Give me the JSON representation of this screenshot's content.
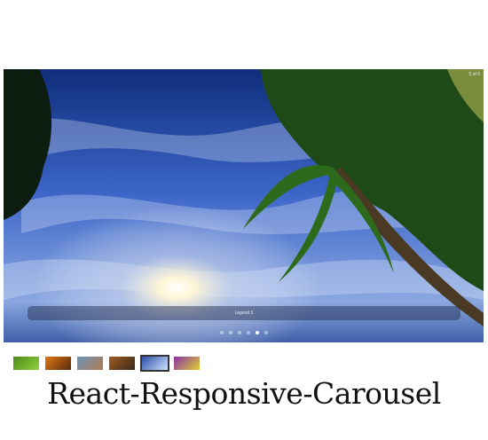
{
  "carousel": {
    "status": "5 of 6",
    "legend": "Legend 5",
    "slide_count": 6,
    "selected_index": 4
  },
  "thumbnails": [
    {
      "name": "thumb-green-leaf",
      "colors": [
        "#4c8b1c",
        "#8fcf3a"
      ]
    },
    {
      "name": "thumb-sunset-sea",
      "colors": [
        "#e07a12",
        "#5a2a10"
      ]
    },
    {
      "name": "thumb-coast-rocks",
      "colors": [
        "#6d93b6",
        "#b07a55"
      ]
    },
    {
      "name": "thumb-autumn-tree",
      "colors": [
        "#a05a20",
        "#3b2a1a"
      ]
    },
    {
      "name": "thumb-palm-sky",
      "colors": [
        "#2a4fa6",
        "#cfe0ff"
      ]
    },
    {
      "name": "thumb-purple-flowers",
      "colors": [
        "#8a2fa8",
        "#e0d030"
      ]
    }
  ],
  "caption": "React-Responsive-Carousel"
}
